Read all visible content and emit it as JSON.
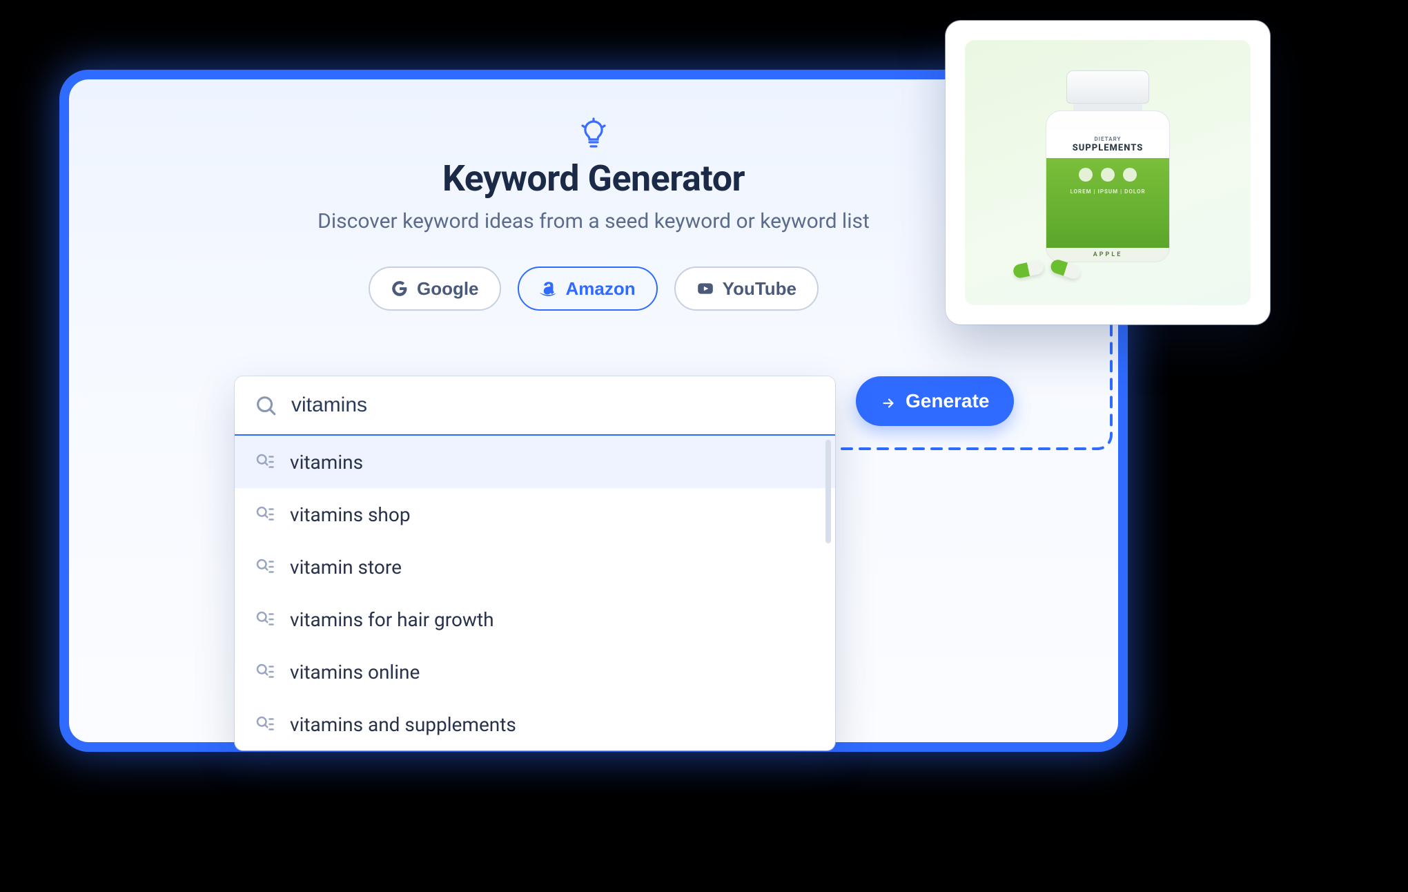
{
  "header": {
    "title": "Keyword Generator",
    "subtitle": "Discover keyword ideas from a seed keyword or keyword list"
  },
  "sources": [
    {
      "id": "google",
      "label": "Google",
      "active": false
    },
    {
      "id": "amazon",
      "label": "Amazon",
      "active": true
    },
    {
      "id": "youtube",
      "label": "YouTube",
      "active": false
    }
  ],
  "search": {
    "value": "vitamins",
    "suggestions": [
      {
        "text": "vitamins",
        "selected": true
      },
      {
        "text": "vitamins shop",
        "selected": false
      },
      {
        "text": "vitamin store",
        "selected": false
      },
      {
        "text": "vitamins for hair growth",
        "selected": false
      },
      {
        "text": "vitamins online",
        "selected": false
      },
      {
        "text": "vitamins and supplements",
        "selected": false
      }
    ]
  },
  "generate_button": "Generate",
  "product_card": {
    "label_line1": "DIETARY",
    "label_line2": "SUPPLEMENTS",
    "flavor": "APPLE",
    "subline": "LOREM  |  IPSUM  |  DOLOR"
  },
  "colors": {
    "accent": "#2f6bff",
    "text": "#1b2a47",
    "muted": "#5a6b8c"
  }
}
